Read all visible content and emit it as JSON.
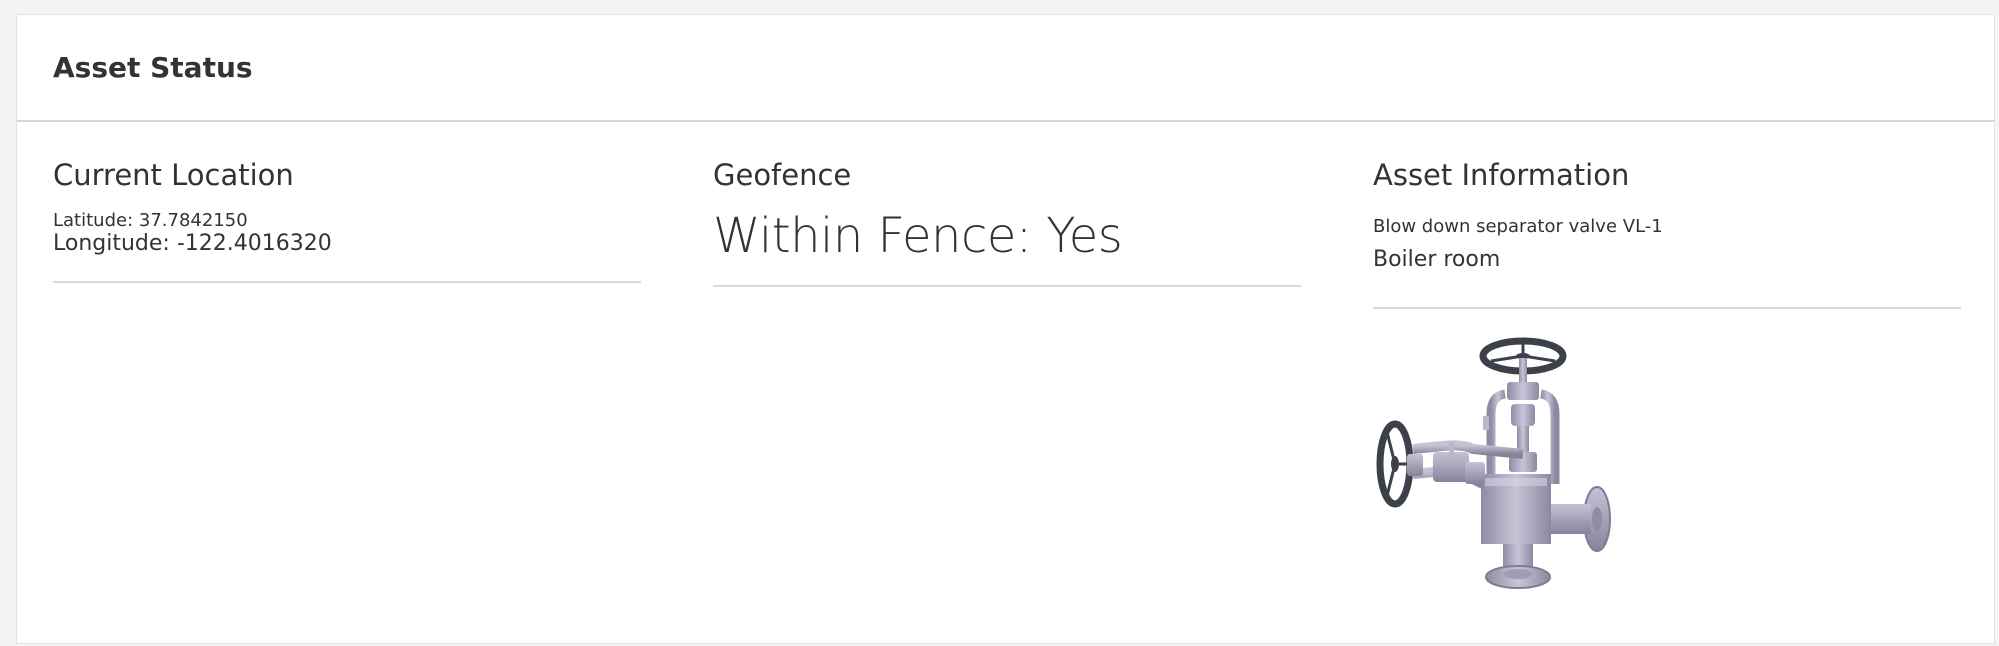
{
  "header": {
    "title": "Asset Status"
  },
  "location": {
    "title": "Current Location",
    "latitude": "Latitude: 37.7842150",
    "longitude": "Longitude: -122.4016320"
  },
  "geofence": {
    "title": "Geofence",
    "status": "Within Fence: Yes"
  },
  "asset": {
    "title": "Asset Information",
    "name": "Blow down separator valve VL-1",
    "location": "Boiler room",
    "image_icon": "valve-image"
  },
  "colors": {
    "background": "#f4f4f4",
    "card": "#ffffff",
    "text": "#333333",
    "divider": "#d9d9d9",
    "valve_metal": "#a9a8bd",
    "handwheel": "#3c4048"
  }
}
